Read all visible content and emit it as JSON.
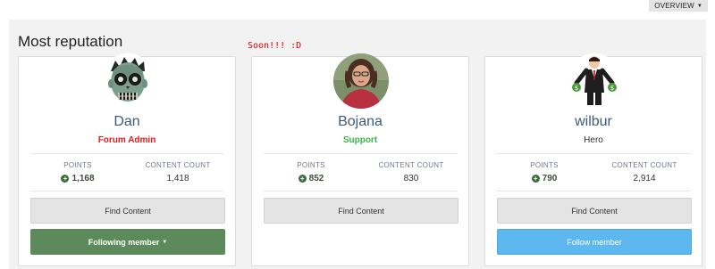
{
  "header": {
    "overview_label": "OVERVIEW"
  },
  "section": {
    "title": "Most reputation",
    "note": "Soon!!! :D"
  },
  "labels": {
    "points": "POINTS",
    "content_count": "CONTENT COUNT",
    "find_content": "Find Content"
  },
  "members": [
    {
      "name": "Dan",
      "role": "Forum Admin",
      "points": "1,168",
      "content_count": "1,418",
      "follow_label": "Following member",
      "avatar": "zombie-avatar"
    },
    {
      "name": "Bojana",
      "role": "Support",
      "points": "852",
      "content_count": "830",
      "avatar": "photo-avatar"
    },
    {
      "name": "wilbur",
      "role": "Hero",
      "points": "790",
      "content_count": "2,914",
      "follow_label": "Follow member",
      "avatar": "businessman-avatar"
    }
  ],
  "colors": {
    "admin": "#e31b1b",
    "support": "#3ab54a",
    "following": "#5d8a5a",
    "follow": "#5cb8ef",
    "name": "#3b5b7a"
  }
}
